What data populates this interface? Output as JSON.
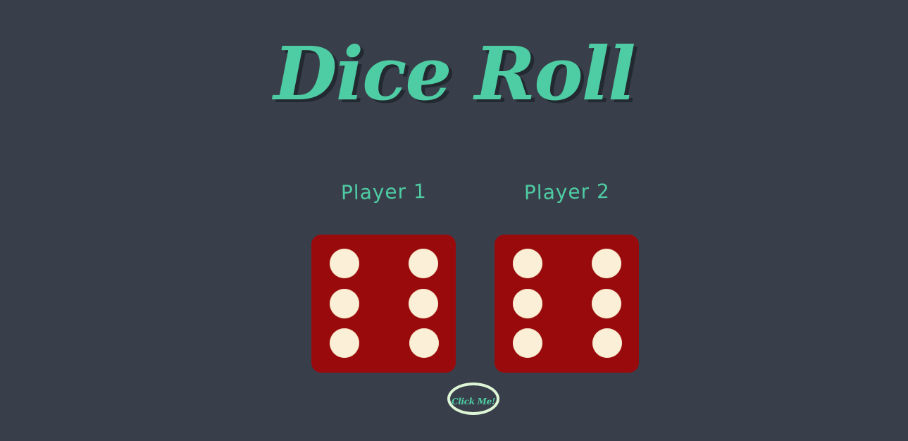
{
  "title": "Dice Roll",
  "players": [
    {
      "label": "Player 1",
      "die_value": 6
    },
    {
      "label": "Player 2",
      "die_value": 6
    }
  ],
  "button": {
    "label": "Click Me!"
  },
  "colors": {
    "background": "#393F4A",
    "accent": "#4ECCA3",
    "die_face": "#990A0D",
    "pip": "#FBEFD7",
    "button_border": "#DDF7D6"
  }
}
